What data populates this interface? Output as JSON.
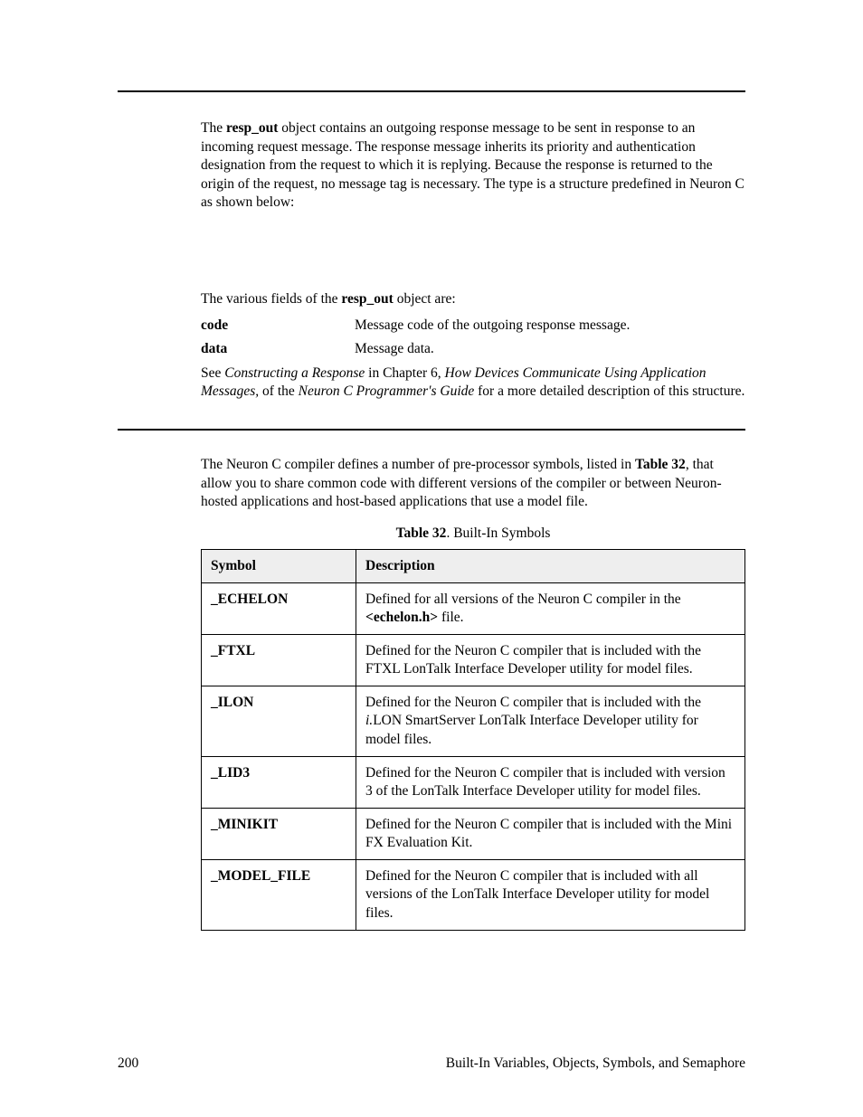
{
  "intro_para_pre": "The ",
  "intro_bold1": "resp_out",
  "intro_para_post": " object contains an outgoing response message to be sent in response to an incoming request message.  The response message inherits its priority and authentication designation from the request to which it is replying.  Because the response is returned to the origin of the request, no message tag is necessary.  The type is a structure predefined in Neuron C as shown below:",
  "fields_intro_pre": "The various fields of the ",
  "fields_intro_bold": "resp_out",
  "fields_intro_post": " object are:",
  "fields": [
    {
      "term": "code",
      "desc": "Message code of the outgoing response message."
    },
    {
      "term": "data",
      "desc": "Message data."
    }
  ],
  "see_pre": "See ",
  "see_i1": "Constructing a Response",
  "see_mid1": " in Chapter 6, ",
  "see_i2": "How Devices Communicate Using Application Messages,",
  "see_mid2": " of the ",
  "see_i3": "Neuron C Programmer's Guide",
  "see_post": " for a more detailed description of this structure.",
  "section2_pre": "The Neuron C compiler defines a number of pre-processor symbols, listed in ",
  "section2_bold": "Table 32",
  "section2_post": ", that allow you to share common code with different versions of the compiler or between Neuron-hosted applications and host-based applications that use a model file.",
  "table_caption_bold": "Table 32",
  "table_caption_rest": ". Built-In Symbols",
  "table_headers": {
    "col1": "Symbol",
    "col2": "Description"
  },
  "rows": [
    {
      "sym": "_ECHELON",
      "desc_pre": "Defined for all versions of the Neuron C compiler in the ",
      "desc_bold": "<echelon.h>",
      "desc_post": " file."
    },
    {
      "sym": "_FTXL",
      "desc_plain": "Defined for the Neuron C compiler that is included with the FTXL LonTalk Interface Developer utility for model files."
    },
    {
      "sym": "_ILON",
      "desc_pre": "Defined for the Neuron C compiler that is included with the ",
      "desc_italic": "i.",
      "desc_post": "LON SmartServer LonTalk Interface Developer utility for model files."
    },
    {
      "sym": "_LID3",
      "desc_plain": "Defined for the Neuron C compiler that is included with version 3 of the LonTalk Interface Developer utility for model files."
    },
    {
      "sym": "_MINIKIT",
      "desc_plain": "Defined for the Neuron C compiler that is included with the Mini FX Evaluation Kit."
    },
    {
      "sym": "_MODEL_FILE",
      "desc_plain": "Defined for the Neuron C compiler that is included with all versions of the LonTalk Interface Developer utility for model files."
    }
  ],
  "footer_left": "200",
  "footer_right": "Built-In Variables, Objects, Symbols, and Semaphore"
}
